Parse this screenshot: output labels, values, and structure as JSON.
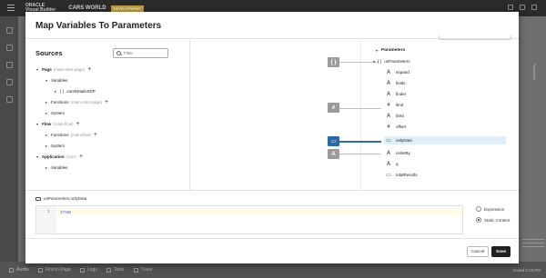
{
  "app": {
    "logo_line1": "ORACLE",
    "logo_line2": "Visual Builder",
    "app_name": "CARS WORLD",
    "env_badge": "DEVELOPMENT",
    "colors": {
      "accent": "#2b6aa8",
      "save_button": "#222222",
      "selected_row": "#dfeef7"
    }
  },
  "background": {
    "properties_tab": "Properties",
    "status": [
      "Audits",
      "Find in Page",
      "Logs",
      "Tests",
      "Trace"
    ],
    "saved": "Saved 2:18 PM"
  },
  "dialog": {
    "title": "Map Variables To Parameters",
    "sources": {
      "title": "Sources",
      "filter_placeholder": "Filter",
      "tree": [
        {
          "label": "Page",
          "sub": "(main-start-page)",
          "plus": "+"
        },
        {
          "label": "Variables"
        },
        {
          "label": "{ }",
          "text": "carsDetailsSDP"
        },
        {
          "label": "Functions",
          "sub": "(main-start-page)",
          "plus": "+"
        },
        {
          "label": "System"
        },
        {
          "label": "Flow",
          "sub": "(main-flow)",
          "plus": "+"
        },
        {
          "label": "Functions",
          "sub": "(main-flow)",
          "plus": "+"
        },
        {
          "label": "System"
        },
        {
          "label": "Application",
          "sub": "(cars)",
          "plus": "+"
        },
        {
          "label": "Variables"
        }
      ]
    },
    "target": {
      "title": "Parameters",
      "group": "uriParameters",
      "items": [
        {
          "icon": "A",
          "label": "expand"
        },
        {
          "icon": "A",
          "label": "fields"
        },
        {
          "icon": "A",
          "label": "finder"
        },
        {
          "icon": "#",
          "label": "limit"
        },
        {
          "icon": "A",
          "label": "links"
        },
        {
          "icon": "#",
          "label": "offset"
        },
        {
          "icon": "tag",
          "label": "onlyData"
        },
        {
          "icon": "A",
          "label": "orderBy"
        },
        {
          "icon": "A",
          "label": "q"
        },
        {
          "icon": "tag",
          "label": "totalResults"
        }
      ]
    },
    "ports": [
      "{ }",
      "#",
      "tag",
      "A"
    ],
    "expression": {
      "label": "uriParameters.onlyData",
      "line_number": "1",
      "code": "true",
      "options": [
        {
          "label": "Expression",
          "selected": false
        },
        {
          "label": "Static Content",
          "selected": true
        }
      ]
    },
    "buttons": {
      "cancel": "Cancel",
      "save": "Save"
    }
  }
}
